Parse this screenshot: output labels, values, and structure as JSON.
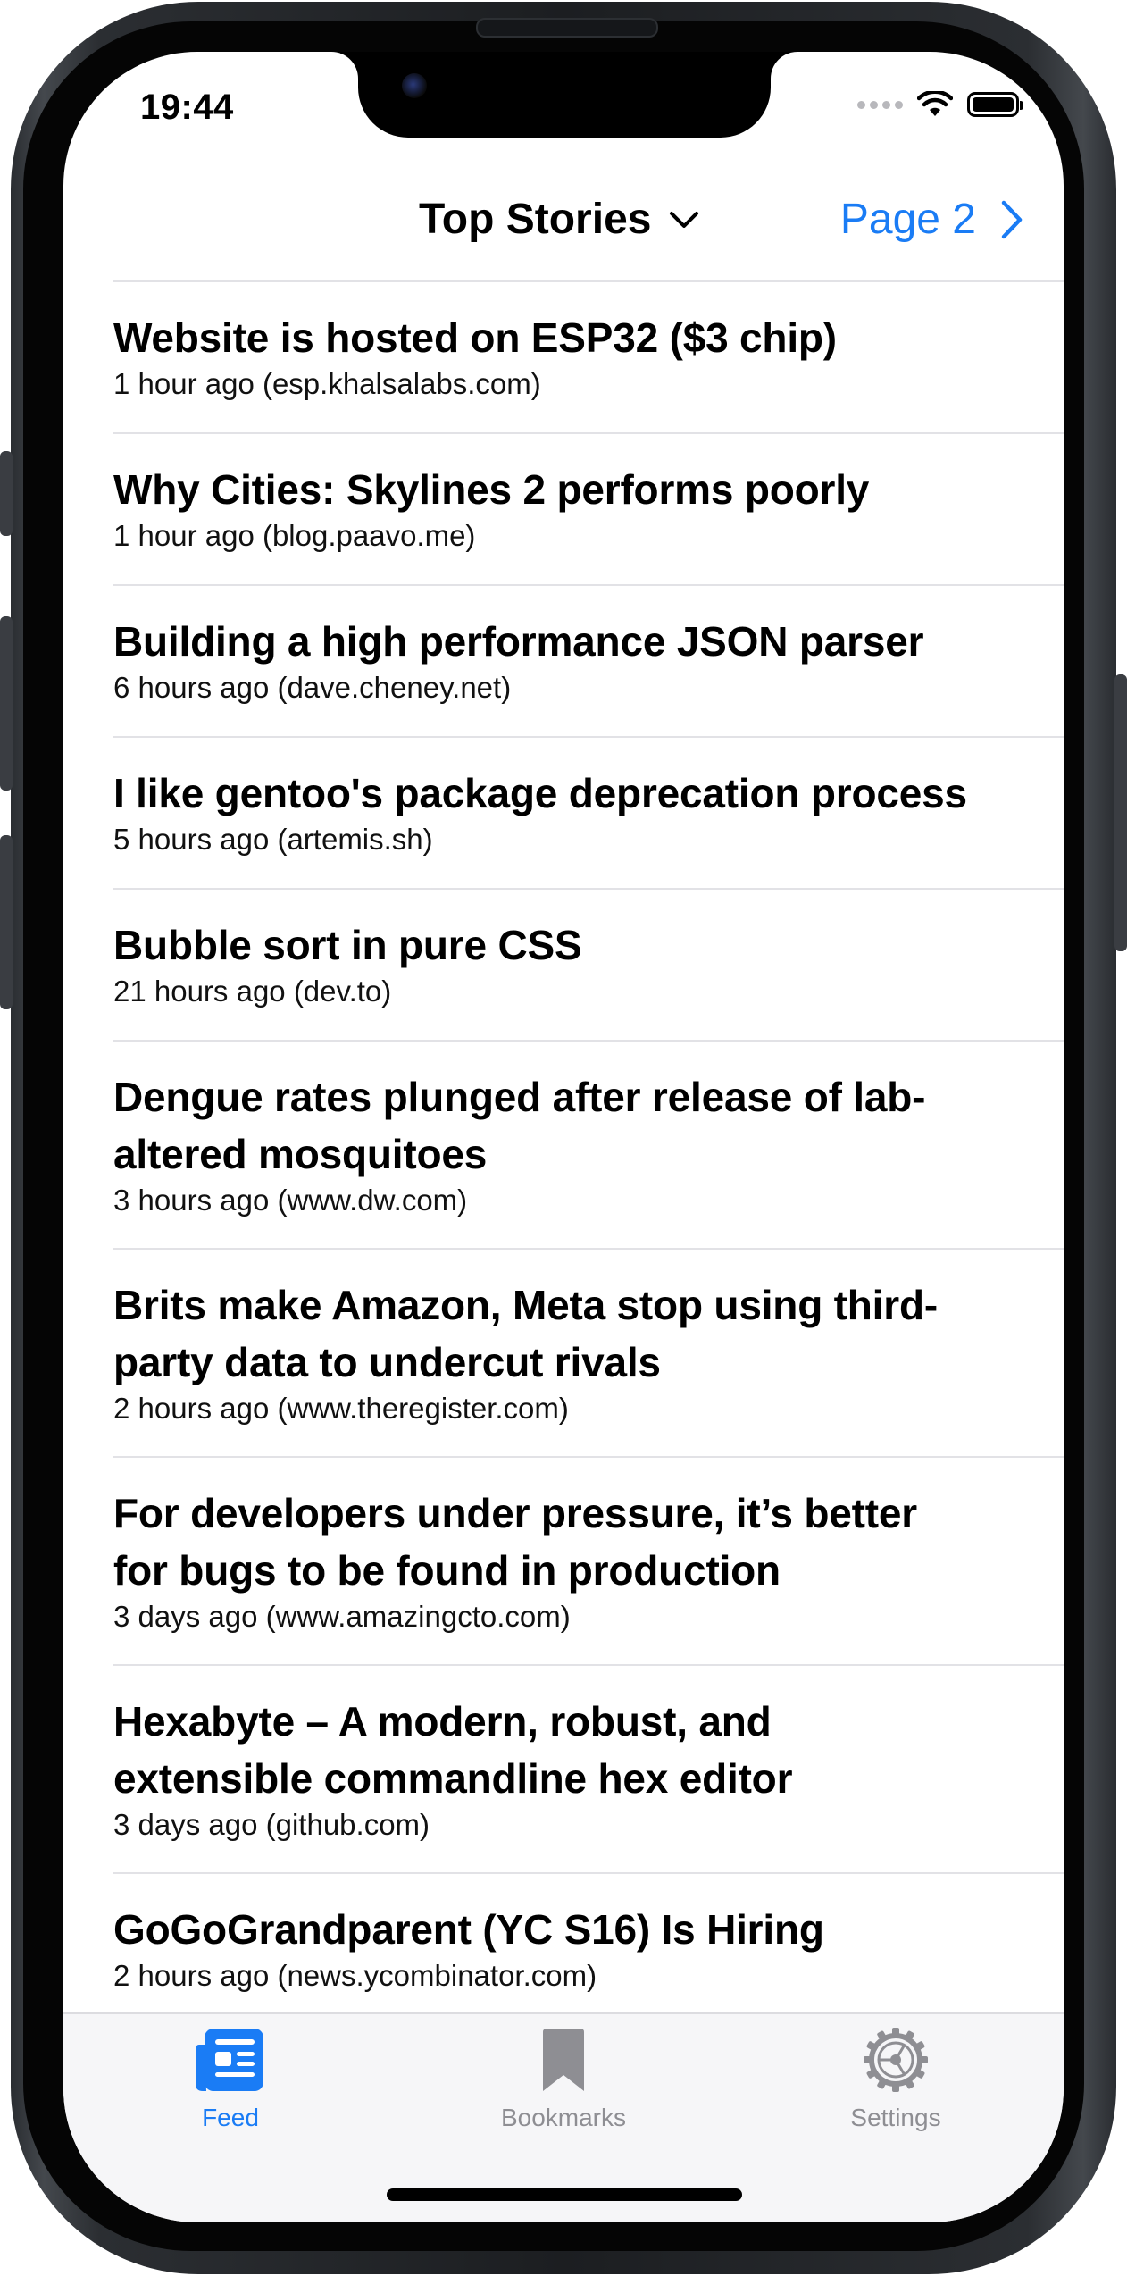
{
  "status_bar": {
    "time": "19:44"
  },
  "nav": {
    "title": "Top Stories",
    "page_label": "Page 2"
  },
  "feed": {
    "items": [
      {
        "title": "Website is hosted on ESP32 ($3 chip)",
        "meta": "1 hour ago (esp.khalsalabs.com)"
      },
      {
        "title": "Why Cities: Skylines 2 performs poorly",
        "meta": "1 hour ago (blog.paavo.me)"
      },
      {
        "title": "Building a high performance JSON parser",
        "meta": "6 hours ago (dave.cheney.net)"
      },
      {
        "title": "I like gentoo's package deprecation process",
        "meta": "5 hours ago (artemis.sh)"
      },
      {
        "title": "Bubble sort in pure CSS",
        "meta": "21 hours ago (dev.to)"
      },
      {
        "title_line1": "Dengue rates plunged after release of lab-",
        "title_line2": "altered mosquitoes",
        "meta": "3 hours ago (www.dw.com)"
      },
      {
        "title_line1": "Brits make Amazon, Meta stop using third-",
        "title_line2": "party data to undercut rivals",
        "meta": "2 hours ago (www.theregister.com)"
      },
      {
        "title_line1": "For developers under pressure, it’s better",
        "title_line2": "for bugs to be found in production",
        "meta": "3 days ago (www.amazingcto.com)"
      },
      {
        "title_line1": "Hexabyte – A modern, robust, and",
        "title_line2": "extensible commandline hex editor",
        "meta": "3 days ago (github.com)"
      },
      {
        "title": "GoGoGrandparent (YC S16) Is Hiring",
        "meta": "2 hours ago (news.ycombinator.com)"
      }
    ]
  },
  "tab_bar": {
    "tabs": [
      {
        "label": "Feed",
        "icon": "newspaper-icon",
        "active": true
      },
      {
        "label": "Bookmarks",
        "icon": "bookmark-icon",
        "active": false
      },
      {
        "label": "Settings",
        "icon": "gear-icon",
        "active": false
      }
    ]
  },
  "colors": {
    "accent": "#1a7cf5",
    "inactive_tab": "#8e8e93",
    "divider": "#e2e2e6",
    "tab_bar_bg": "#f6f6f8"
  }
}
